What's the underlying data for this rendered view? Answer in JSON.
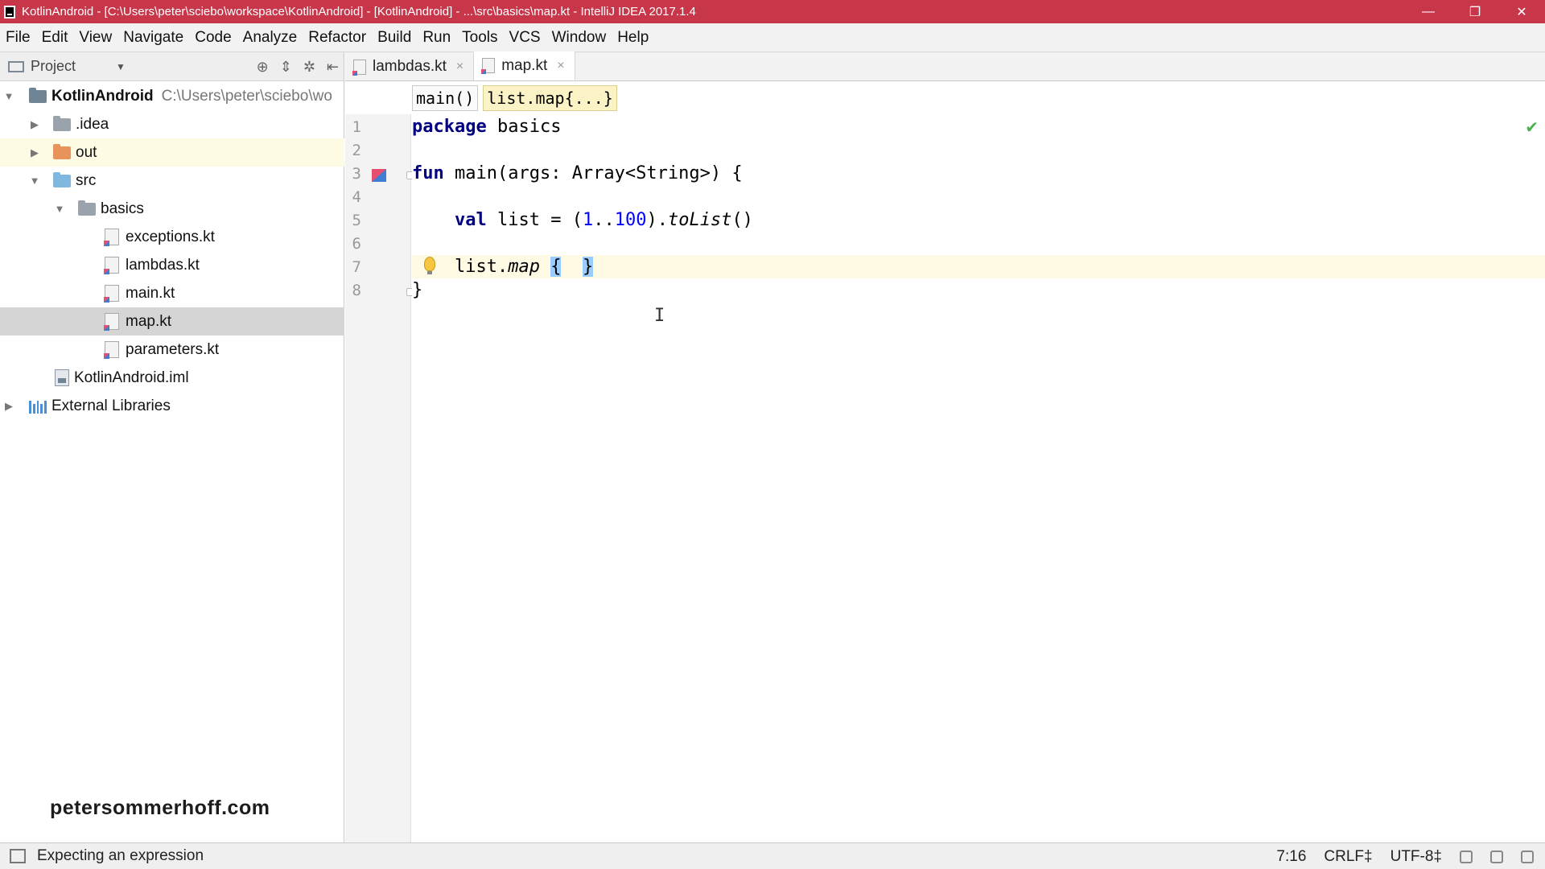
{
  "window": {
    "title": "KotlinAndroid - [C:\\Users\\peter\\sciebo\\workspace\\KotlinAndroid] - [KotlinAndroid] - ...\\src\\basics\\map.kt - IntelliJ IDEA 2017.1.4",
    "minimize": "—",
    "restore": "❐",
    "close": "✕"
  },
  "menu": [
    "File",
    "Edit",
    "View",
    "Navigate",
    "Code",
    "Analyze",
    "Refactor",
    "Build",
    "Run",
    "Tools",
    "VCS",
    "Window",
    "Help"
  ],
  "project_panel": {
    "title": "Project",
    "caret": "▼",
    "tools": [
      "⊕",
      "⇕",
      "✲",
      "⇤"
    ],
    "tree": [
      {
        "label": "KotlinAndroid",
        "path": "C:\\Users\\peter\\sciebo\\wo",
        "arrow": "▼"
      },
      {
        "label": ".idea",
        "arrow": "▶"
      },
      {
        "label": "out",
        "arrow": "▶"
      },
      {
        "label": "src",
        "arrow": "▼"
      },
      {
        "label": "basics",
        "arrow": "▼"
      },
      {
        "label": "exceptions.kt"
      },
      {
        "label": "lambdas.kt"
      },
      {
        "label": "main.kt"
      },
      {
        "label": "map.kt"
      },
      {
        "label": "parameters.kt"
      },
      {
        "label": "KotlinAndroid.iml"
      },
      {
        "label": "External Libraries",
        "arrow": "▶"
      }
    ]
  },
  "watermark": "petersommerhoff.com",
  "tabs": [
    {
      "label": "lambdas.kt",
      "close": "×"
    },
    {
      "label": "map.kt",
      "close": "×"
    }
  ],
  "breadcrumb": [
    "main()",
    "list.map{...}"
  ],
  "editor": {
    "line_numbers": [
      "1",
      "2",
      "3",
      "4",
      "5",
      "6",
      "7",
      "8"
    ],
    "code": {
      "l1_kw": "package",
      "l1_rest": " basics",
      "l3_kw": "fun",
      "l3_rest": " main(args: Array<String>) {",
      "l5_indent": "    ",
      "l5_kw": "val",
      "l5_a": " list = (",
      "l5_n1": "1",
      "l5_dots": "..",
      "l5_n2": "100",
      "l5_b": ").",
      "l5_call": "toList",
      "l5_c": "()",
      "l7_indent": "    ",
      "l7_a": "list.",
      "l7_call": "map",
      "l7_sp": " ",
      "l7_open": "{",
      "l7_mid": "  ",
      "l7_close": "}",
      "l8": "}"
    },
    "check": "✔",
    "cursor": "I"
  },
  "status": {
    "message": "Expecting an expression",
    "position": "7:16",
    "line_sep": "CRLF‡",
    "encoding": "UTF-8‡"
  },
  "colors": {
    "titlebar": "#c8364a",
    "keyword": "#000080",
    "number": "#0000ff",
    "current_line": "#fffae3"
  }
}
